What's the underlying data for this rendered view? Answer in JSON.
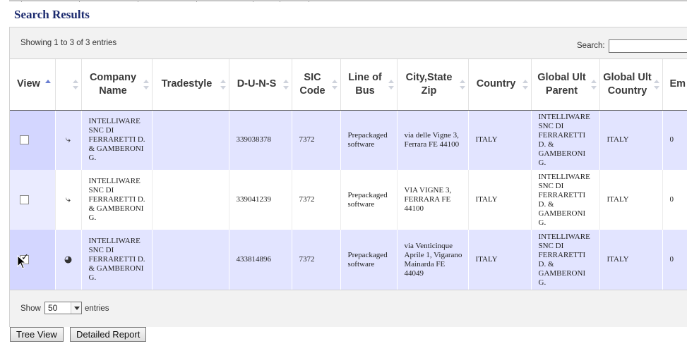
{
  "page": {
    "title": "Search Results"
  },
  "table_info": {
    "text": "Showing 1 to 3 of 3 entries"
  },
  "search": {
    "label": "Search:",
    "value": ""
  },
  "columns": [
    {
      "label": "View"
    },
    {
      "label": ""
    },
    {
      "label": "Company Name"
    },
    {
      "label": "Tradestyle"
    },
    {
      "label": "D-U-N-S"
    },
    {
      "label": "SIC Code"
    },
    {
      "label": "Line of Bus"
    },
    {
      "label": "City,State Zip"
    },
    {
      "label": "Country"
    },
    {
      "label": "Global Ult Parent"
    },
    {
      "label": "Global Ult Country"
    },
    {
      "label": "Em"
    }
  ],
  "rows": [
    {
      "checked": false,
      "icon": "link-icon",
      "icon_glyph": "⤷",
      "company_name": "INTELLIWARE SNC DI FERRARETTI D. & GAMBERONI G.",
      "tradestyle": "",
      "duns": "339038378",
      "sic_code": "7372",
      "line_of_bus": "Prepackaged software",
      "city_state_zip": "via delle Vigne 3, Ferrara FE 44100",
      "country": "ITALY",
      "global_ult_parent": "INTELLIWARE SNC DI FERRARETTI D. & GAMBERONI G.",
      "global_ult_country": "ITALY",
      "em": "0"
    },
    {
      "checked": false,
      "icon": "link-icon",
      "icon_glyph": "⤷",
      "company_name": "INTELLIWARE SNC DI FERRARETTI D. & GAMBERONI G.",
      "tradestyle": "",
      "duns": "339041239",
      "sic_code": "7372",
      "line_of_bus": "Prepackaged software",
      "city_state_zip": "VIA VIGNE 3, FERRARA FE 44100",
      "country": "ITALY",
      "global_ult_parent": "INTELLIWARE SNC DI FERRARETTI D. & GAMBERONI G.",
      "global_ult_country": "ITALY",
      "em": "0"
    },
    {
      "checked": true,
      "icon": "headquarters-icon",
      "icon_glyph": "◕",
      "company_name": "INTELLIWARE SNC DI FERRARETTI D. & GAMBERONI G.",
      "tradestyle": "",
      "duns": "433814896",
      "sic_code": "7372",
      "line_of_bus": "Prepackaged software",
      "city_state_zip": "via Venticinque Aprile 1, Vigarano Mainarda FE 44049",
      "country": "ITALY",
      "global_ult_parent": "INTELLIWARE SNC DI FERRARETTI D. & GAMBERONI G.",
      "global_ult_country": "ITALY",
      "em": "0"
    }
  ],
  "length_menu": {
    "show_label": "Show",
    "selected": "50",
    "entries_label": "entries"
  },
  "buttons": {
    "tree_view": "Tree View",
    "detailed_report": "Detailed Report"
  }
}
